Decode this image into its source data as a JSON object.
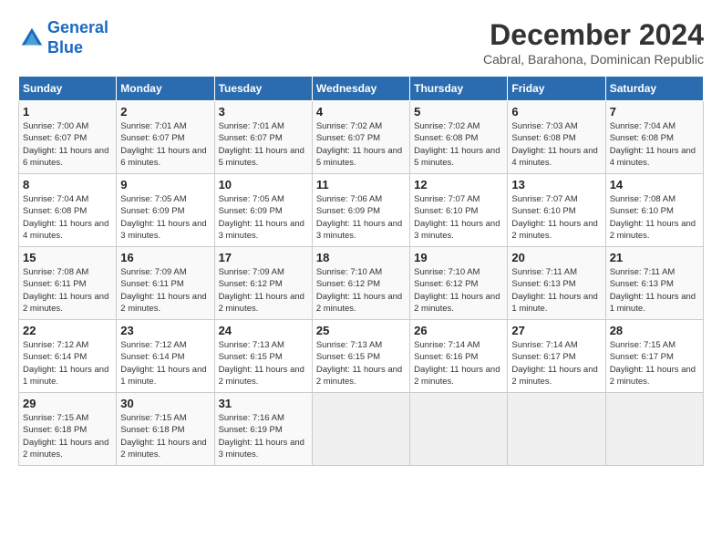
{
  "header": {
    "logo_line1": "General",
    "logo_line2": "Blue",
    "month_title": "December 2024",
    "location": "Cabral, Barahona, Dominican Republic"
  },
  "columns": [
    "Sunday",
    "Monday",
    "Tuesday",
    "Wednesday",
    "Thursday",
    "Friday",
    "Saturday"
  ],
  "weeks": [
    [
      {
        "day": "1",
        "info": "Sunrise: 7:00 AM\nSunset: 6:07 PM\nDaylight: 11 hours and 6 minutes."
      },
      {
        "day": "2",
        "info": "Sunrise: 7:01 AM\nSunset: 6:07 PM\nDaylight: 11 hours and 6 minutes."
      },
      {
        "day": "3",
        "info": "Sunrise: 7:01 AM\nSunset: 6:07 PM\nDaylight: 11 hours and 5 minutes."
      },
      {
        "day": "4",
        "info": "Sunrise: 7:02 AM\nSunset: 6:07 PM\nDaylight: 11 hours and 5 minutes."
      },
      {
        "day": "5",
        "info": "Sunrise: 7:02 AM\nSunset: 6:08 PM\nDaylight: 11 hours and 5 minutes."
      },
      {
        "day": "6",
        "info": "Sunrise: 7:03 AM\nSunset: 6:08 PM\nDaylight: 11 hours and 4 minutes."
      },
      {
        "day": "7",
        "info": "Sunrise: 7:04 AM\nSunset: 6:08 PM\nDaylight: 11 hours and 4 minutes."
      }
    ],
    [
      {
        "day": "8",
        "info": "Sunrise: 7:04 AM\nSunset: 6:08 PM\nDaylight: 11 hours and 4 minutes."
      },
      {
        "day": "9",
        "info": "Sunrise: 7:05 AM\nSunset: 6:09 PM\nDaylight: 11 hours and 3 minutes."
      },
      {
        "day": "10",
        "info": "Sunrise: 7:05 AM\nSunset: 6:09 PM\nDaylight: 11 hours and 3 minutes."
      },
      {
        "day": "11",
        "info": "Sunrise: 7:06 AM\nSunset: 6:09 PM\nDaylight: 11 hours and 3 minutes."
      },
      {
        "day": "12",
        "info": "Sunrise: 7:07 AM\nSunset: 6:10 PM\nDaylight: 11 hours and 3 minutes."
      },
      {
        "day": "13",
        "info": "Sunrise: 7:07 AM\nSunset: 6:10 PM\nDaylight: 11 hours and 2 minutes."
      },
      {
        "day": "14",
        "info": "Sunrise: 7:08 AM\nSunset: 6:10 PM\nDaylight: 11 hours and 2 minutes."
      }
    ],
    [
      {
        "day": "15",
        "info": "Sunrise: 7:08 AM\nSunset: 6:11 PM\nDaylight: 11 hours and 2 minutes."
      },
      {
        "day": "16",
        "info": "Sunrise: 7:09 AM\nSunset: 6:11 PM\nDaylight: 11 hours and 2 minutes."
      },
      {
        "day": "17",
        "info": "Sunrise: 7:09 AM\nSunset: 6:12 PM\nDaylight: 11 hours and 2 minutes."
      },
      {
        "day": "18",
        "info": "Sunrise: 7:10 AM\nSunset: 6:12 PM\nDaylight: 11 hours and 2 minutes."
      },
      {
        "day": "19",
        "info": "Sunrise: 7:10 AM\nSunset: 6:12 PM\nDaylight: 11 hours and 2 minutes."
      },
      {
        "day": "20",
        "info": "Sunrise: 7:11 AM\nSunset: 6:13 PM\nDaylight: 11 hours and 1 minute."
      },
      {
        "day": "21",
        "info": "Sunrise: 7:11 AM\nSunset: 6:13 PM\nDaylight: 11 hours and 1 minute."
      }
    ],
    [
      {
        "day": "22",
        "info": "Sunrise: 7:12 AM\nSunset: 6:14 PM\nDaylight: 11 hours and 1 minute."
      },
      {
        "day": "23",
        "info": "Sunrise: 7:12 AM\nSunset: 6:14 PM\nDaylight: 11 hours and 1 minute."
      },
      {
        "day": "24",
        "info": "Sunrise: 7:13 AM\nSunset: 6:15 PM\nDaylight: 11 hours and 2 minutes."
      },
      {
        "day": "25",
        "info": "Sunrise: 7:13 AM\nSunset: 6:15 PM\nDaylight: 11 hours and 2 minutes."
      },
      {
        "day": "26",
        "info": "Sunrise: 7:14 AM\nSunset: 6:16 PM\nDaylight: 11 hours and 2 minutes."
      },
      {
        "day": "27",
        "info": "Sunrise: 7:14 AM\nSunset: 6:17 PM\nDaylight: 11 hours and 2 minutes."
      },
      {
        "day": "28",
        "info": "Sunrise: 7:15 AM\nSunset: 6:17 PM\nDaylight: 11 hours and 2 minutes."
      }
    ],
    [
      {
        "day": "29",
        "info": "Sunrise: 7:15 AM\nSunset: 6:18 PM\nDaylight: 11 hours and 2 minutes."
      },
      {
        "day": "30",
        "info": "Sunrise: 7:15 AM\nSunset: 6:18 PM\nDaylight: 11 hours and 2 minutes."
      },
      {
        "day": "31",
        "info": "Sunrise: 7:16 AM\nSunset: 6:19 PM\nDaylight: 11 hours and 3 minutes."
      },
      {
        "day": "",
        "info": ""
      },
      {
        "day": "",
        "info": ""
      },
      {
        "day": "",
        "info": ""
      },
      {
        "day": "",
        "info": ""
      }
    ]
  ]
}
